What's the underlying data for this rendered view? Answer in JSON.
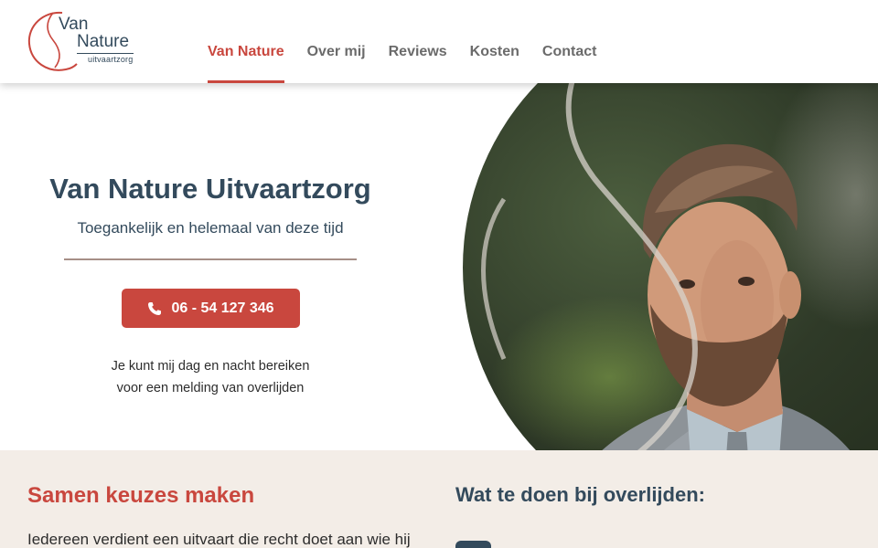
{
  "brand": {
    "logo_van": "Van",
    "logo_nature": "Nature",
    "logo_sub": "uitvaartzorg",
    "accent_color": "#c9473e",
    "dark_color": "#334a5c"
  },
  "nav": {
    "items": [
      {
        "label": "Van Nature",
        "active": true
      },
      {
        "label": "Over mij",
        "active": false
      },
      {
        "label": "Reviews",
        "active": false
      },
      {
        "label": "Kosten",
        "active": false
      },
      {
        "label": "Contact",
        "active": false
      }
    ]
  },
  "hero": {
    "title": "Van Nature Uitvaartzorg",
    "subtitle": "Toegankelijk en helemaal van deze tijd",
    "call_button": {
      "label": "06 - 54 127 346",
      "icon": "phone-icon"
    },
    "note_line1": "Je kunt mij dag en nacht bereiken",
    "note_line2": "voor een melding van overlijden",
    "photo": "portrait-photo"
  },
  "lower": {
    "left_title": "Samen keuzes maken",
    "left_text": "Iedereen verdient een uitvaart die recht doet aan wie hij",
    "right_title": "Wat te doen bij overlijden:"
  }
}
